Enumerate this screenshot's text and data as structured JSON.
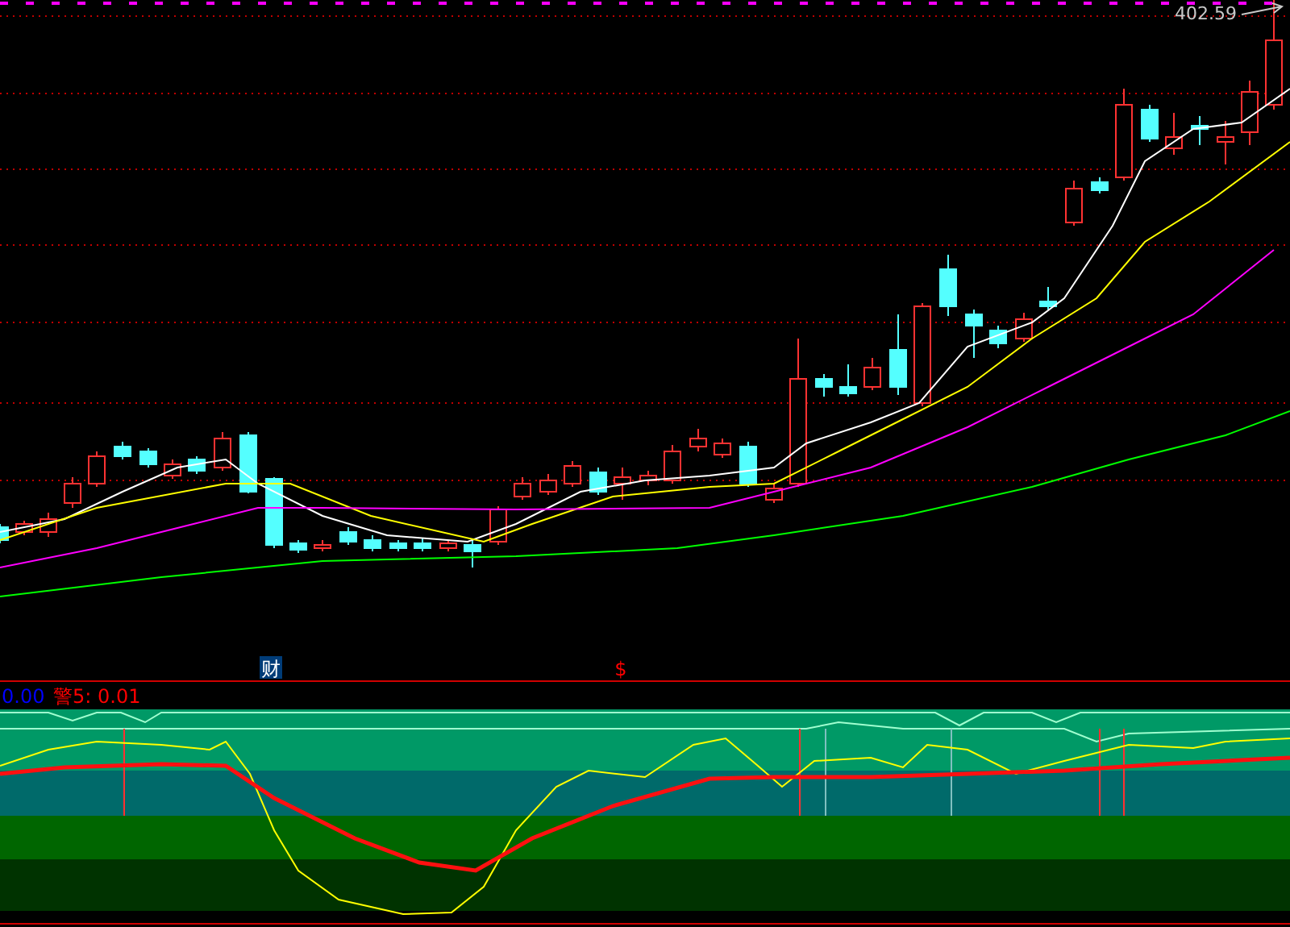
{
  "price_chart": {
    "high_label": "402.59",
    "markers": [
      {
        "text": "财",
        "kind": "finance"
      },
      {
        "text": "$",
        "kind": "dividend"
      }
    ]
  },
  "indicator": {
    "legend": [
      {
        "text": "0.00",
        "color": "#0000ff"
      },
      {
        "text": "警5: 0.01",
        "color": "#ff0000"
      }
    ]
  }
}
